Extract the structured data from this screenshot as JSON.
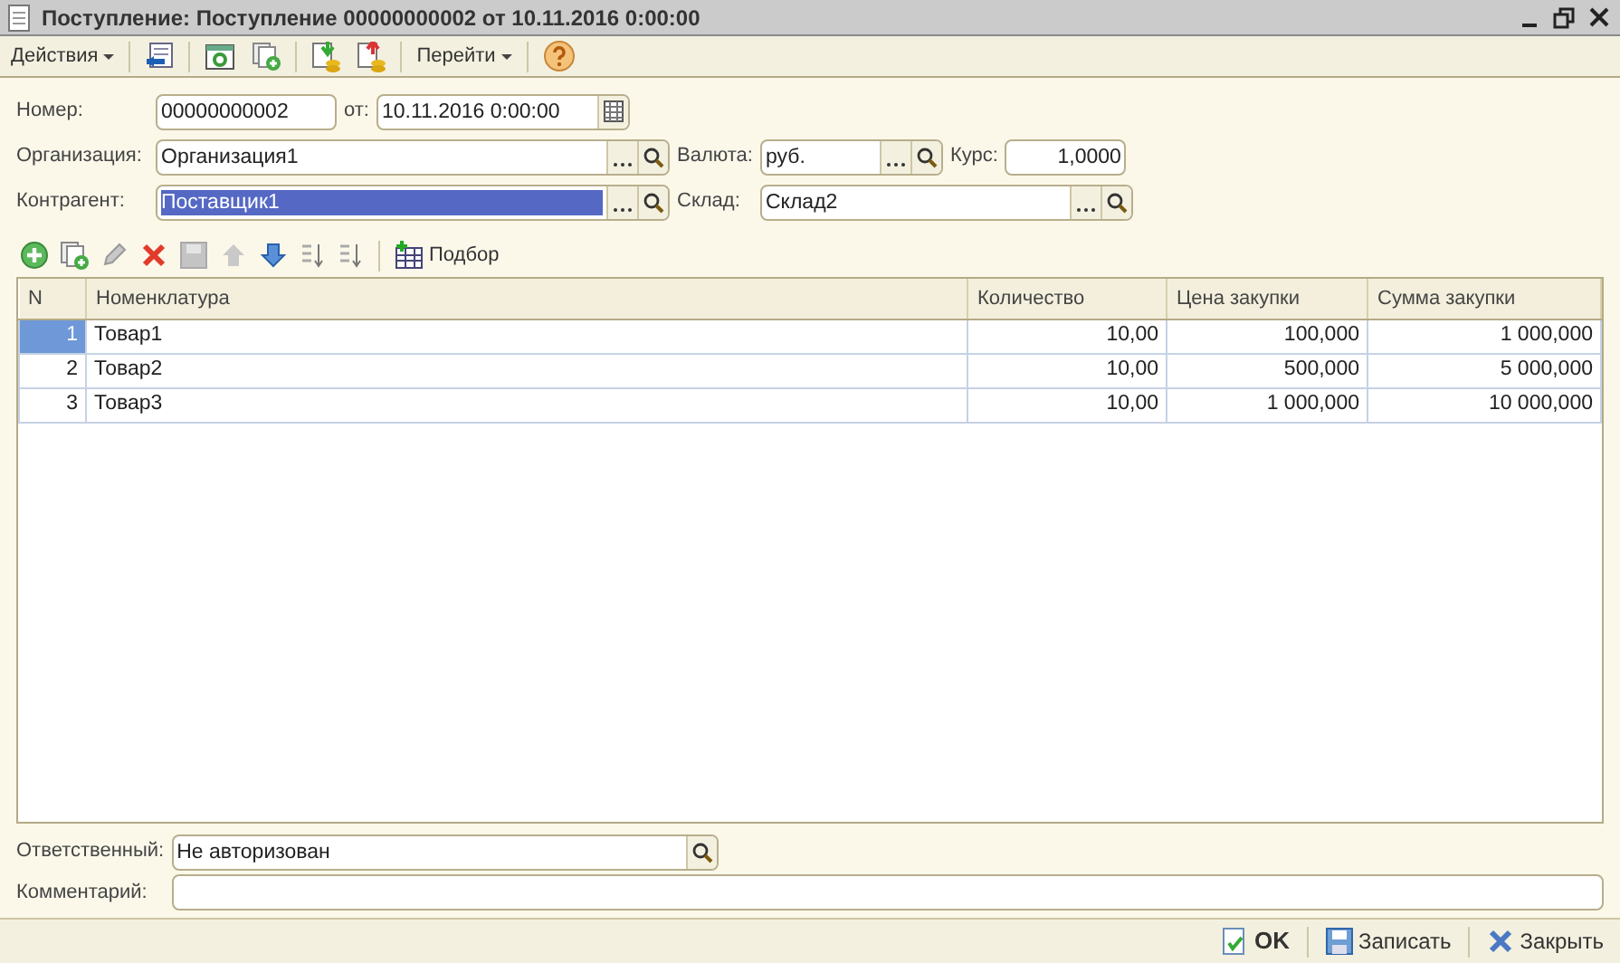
{
  "window": {
    "title": "Поступление: Поступление 00000000002 от 10.11.2016 0:00:00"
  },
  "toolbar": {
    "menus": [
      "Действия",
      "Перейти"
    ]
  },
  "header": {
    "number": {
      "label": "Номер:",
      "value": "00000000002"
    },
    "date": {
      "label": "от:",
      "value": "10.11.2016  0:00:00"
    },
    "organization": {
      "label": "Организация:",
      "value": "Организация1"
    },
    "currency": {
      "label": "Валюта:",
      "value": "руб."
    },
    "rate": {
      "label": "Курс:",
      "value": "1,0000"
    },
    "counterparty": {
      "label": "Контрагент:",
      "value": "Поставщик1",
      "selected": true
    },
    "warehouse": {
      "label": "Склад:",
      "value": "Склад2"
    }
  },
  "table_toolbar": {
    "pick_label": "Подбор"
  },
  "table": {
    "columns": [
      "N",
      "Номенклатура",
      "Количество",
      "Цена закупки",
      "Сумма закупки"
    ],
    "rows": [
      {
        "cells": [
          "1",
          "Товар1",
          "10,00",
          "100,000",
          "1 000,000"
        ],
        "selected": true
      },
      {
        "cells": [
          "2",
          "Товар2",
          "10,00",
          "500,000",
          "5 000,000"
        ],
        "selected": false
      },
      {
        "cells": [
          "3",
          "Товар3",
          "10,00",
          "1 000,000",
          "10 000,000"
        ],
        "selected": false
      }
    ]
  },
  "footer_fields": {
    "responsible": {
      "label": "Ответственный:",
      "value": "Не авторизован"
    },
    "comment": {
      "label": "Комментарий:"
    }
  },
  "buttons": [
    {
      "kind": "ok",
      "label": "OK"
    },
    {
      "kind": "save",
      "label": "Записать"
    },
    {
      "kind": "close",
      "label": "Закрыть"
    }
  ]
}
